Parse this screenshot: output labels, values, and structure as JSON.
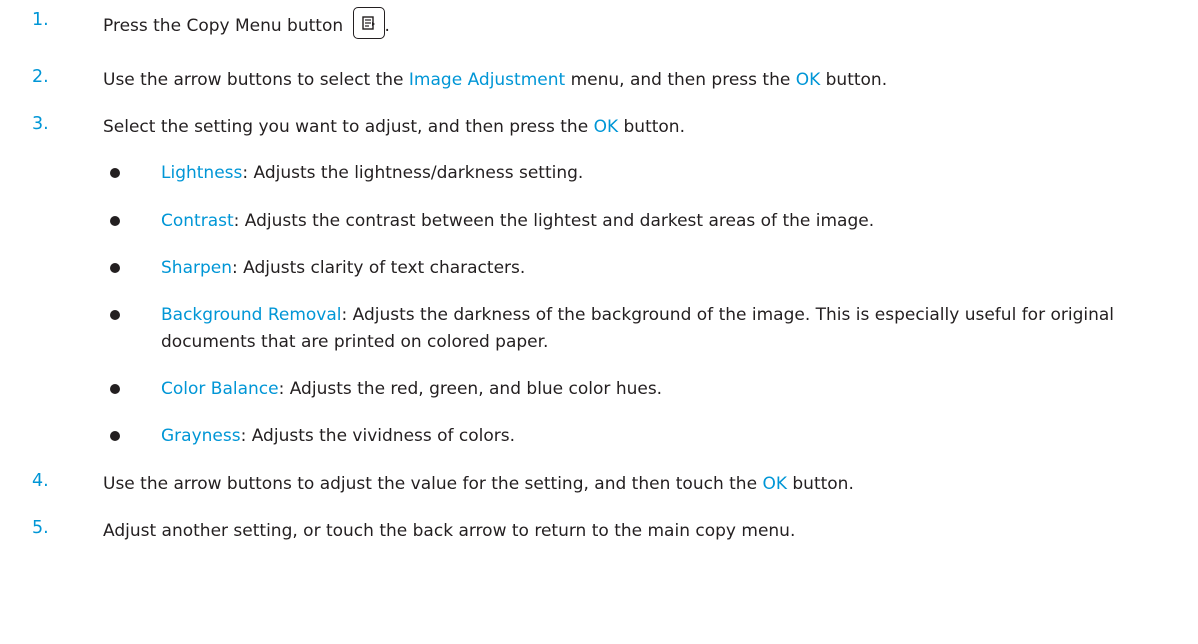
{
  "steps": [
    {
      "number": "1.",
      "text_before": "Press the Copy Menu button ",
      "icon": "copy-menu-icon",
      "text_after": "."
    },
    {
      "number": "2.",
      "t1": "Use the arrow buttons to select the ",
      "h1": "Image Adjustment",
      "t2": " menu, and then press the ",
      "h2": "OK",
      "t3": " button."
    },
    {
      "number": "3.",
      "t1": "Select the setting you want to adjust, and then press the ",
      "h1": "OK",
      "t2": " button."
    },
    {
      "number": "4.",
      "t1": "Use the arrow buttons to adjust the value for the setting, and then touch the ",
      "h1": "OK",
      "t2": " button."
    },
    {
      "number": "5.",
      "text": "Adjust another setting, or touch the back arrow to return to the main copy menu."
    }
  ],
  "settings": [
    {
      "name": "Lightness",
      "description": ": Adjusts the lightness/darkness setting."
    },
    {
      "name": "Contrast",
      "description": ": Adjusts the contrast between the lightest and darkest areas of the image."
    },
    {
      "name": "Sharpen",
      "description": ": Adjusts clarity of text characters."
    },
    {
      "name": "Background Removal",
      "description": ": Adjusts the darkness of the background of the image. This is especially useful for original documents that are printed on colored paper."
    },
    {
      "name": "Color Balance",
      "description": ": Adjusts the red, green, and blue color hues."
    },
    {
      "name": "Grayness",
      "description": ": Adjusts the vividness of colors."
    }
  ],
  "colors": {
    "accent": "#0096d6",
    "text": "#231f20"
  }
}
